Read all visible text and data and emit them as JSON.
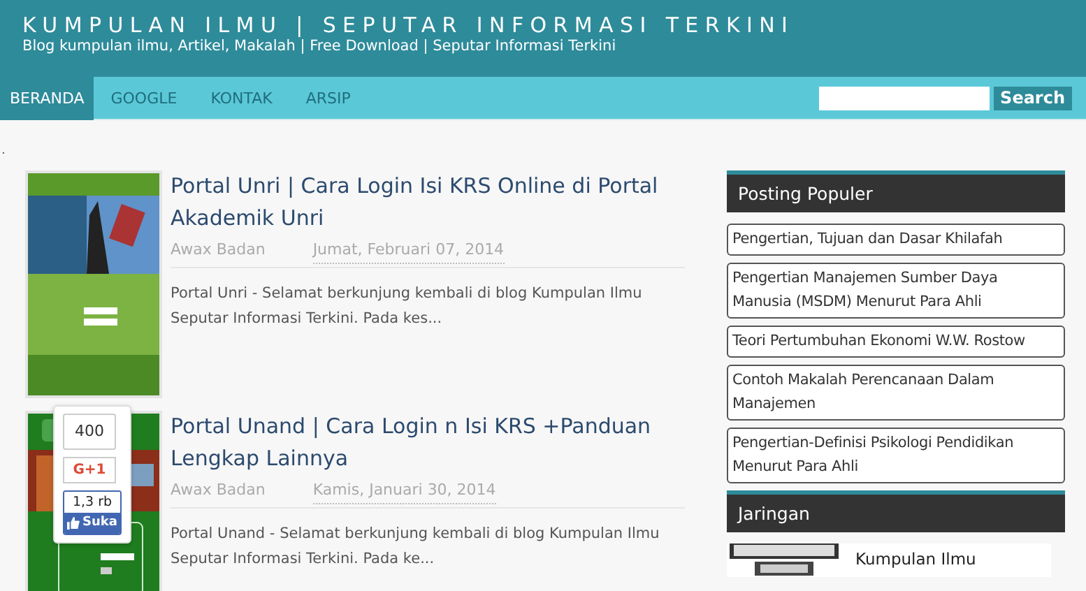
{
  "header": {
    "title": "KUMPULAN ILMU | SEPUTAR INFORMASI TERKINI",
    "tagline": "Blog kumpulan ilmu, Artikel, Makalah | Free Download | Seputar Informasi Terkini"
  },
  "nav": {
    "items": [
      {
        "label": "BERANDA",
        "selected": true
      },
      {
        "label": "GOOGLE",
        "selected": false
      },
      {
        "label": "KONTAK",
        "selected": false
      },
      {
        "label": "ARSIP",
        "selected": false
      }
    ],
    "search_button": "Search"
  },
  "stray_mark": ".",
  "posts": [
    {
      "title": "Portal Unri | Cara Login Isi KRS Online di Portal Akademik Unri",
      "author": "Awax Badan",
      "date": "Jumat, Februari 07, 2014",
      "excerpt": "Portal Unri - Selamat berkunjung kembali di blog Kumpulan Ilmu Seputar Informasi Terkini. Pada kes..."
    },
    {
      "title": "Portal Unand | Cara Login n Isi KRS +Panduan Lengkap Lainnya",
      "author": "Awax Badan",
      "date": "Kamis, Januari 30, 2014",
      "excerpt": "Portal Unand - Selamat berkunjung kembali di blog Kumpulan Ilmu Seputar Informasi Terkini. Pada ke..."
    }
  ],
  "share_widget": {
    "count": "400",
    "gplus": "G+1",
    "like_count": "1,3 rb",
    "like": "Suka"
  },
  "sidebar": {
    "popular_title": "Posting Populer",
    "popular": [
      "Pengertian, Tujuan dan Dasar Khilafah",
      "Pengertian Manajemen Sumber Daya Manusia (MSDM) Menurut Para Ahli",
      "Teori Pertumbuhan Ekonomi W.W. Rostow",
      "Contoh Makalah Perencanaan Dalam Manajemen",
      "Pengertian-Definisi Psikologi Pendidikan Menurut Para Ahli"
    ],
    "network_title": "Jaringan",
    "network": [
      {
        "name": "Kumpulan Ilmu"
      }
    ]
  }
}
